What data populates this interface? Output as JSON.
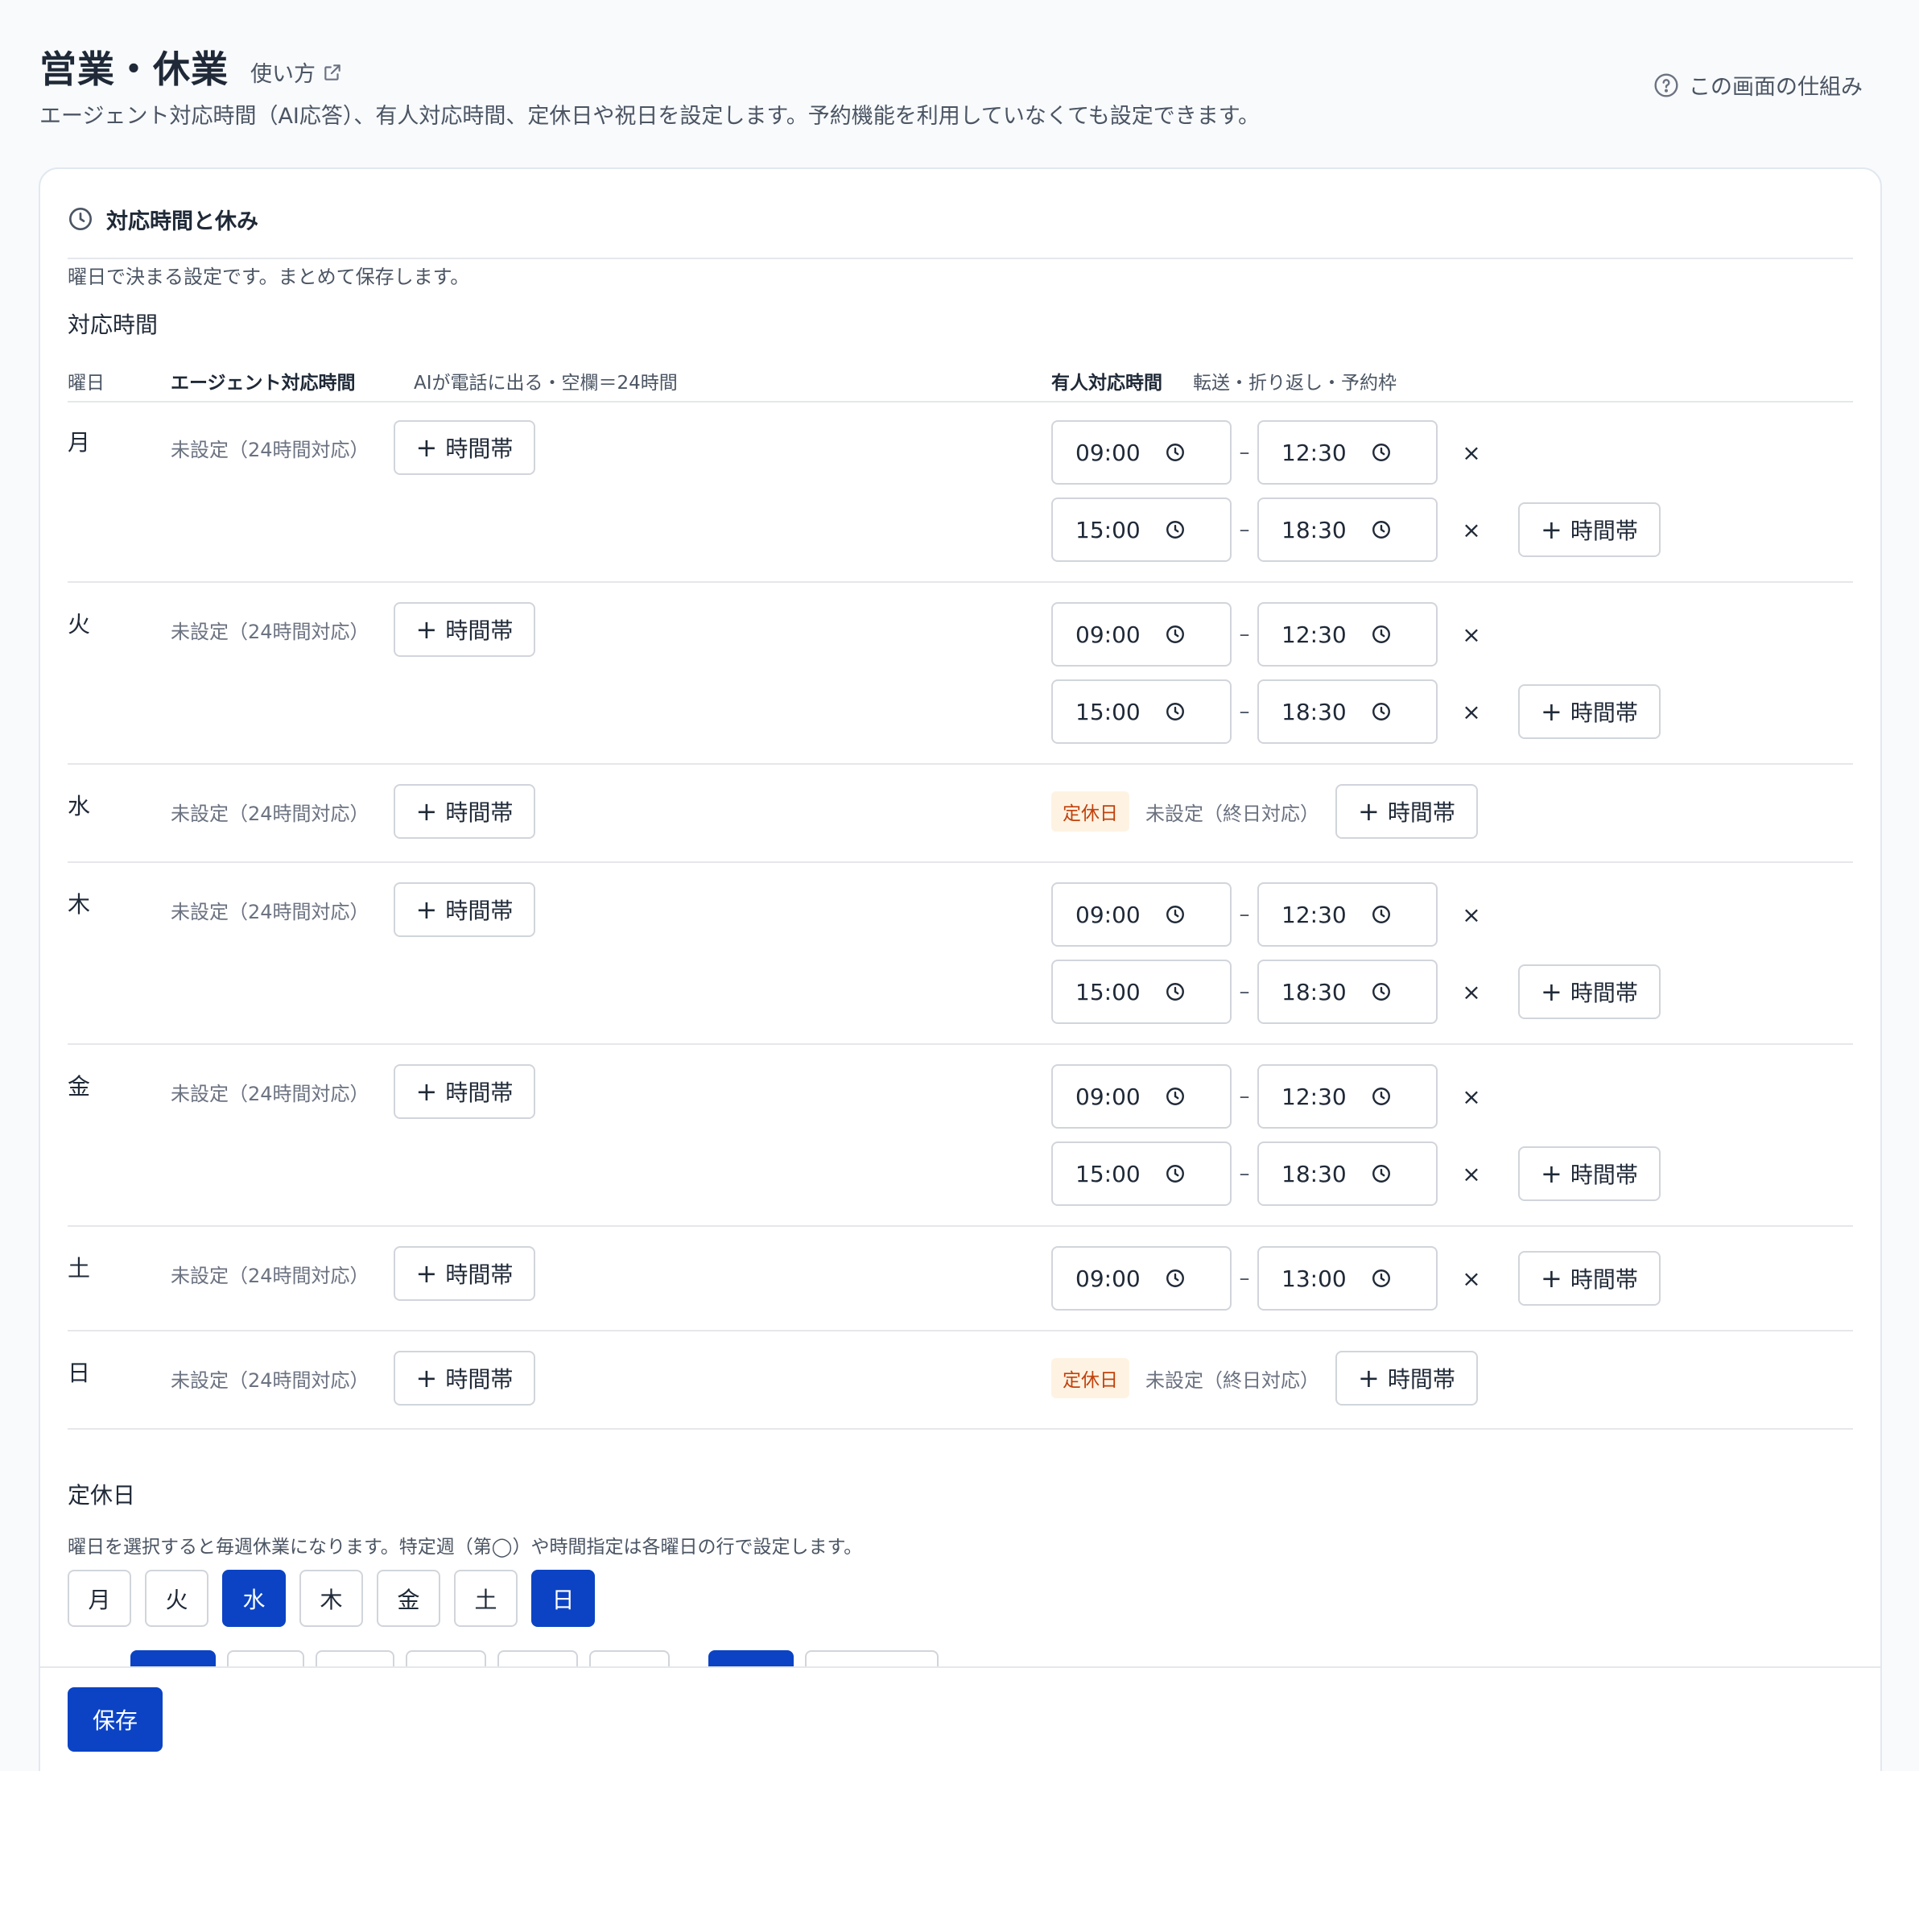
{
  "header": {
    "title": "営業・休業",
    "help_link": "使い方",
    "subtitle": "エージェント対応時間（AI応答）、有人対応時間、定休日や祝日を設定します。予約機能を利用していなくても設定できます。",
    "howto": "この画面の仕組み"
  },
  "card": {
    "title": "対応時間と休み",
    "description": "曜日で決まる設定です。まとめて保存します。",
    "section_title": "対応時間",
    "columns": {
      "day": "曜日",
      "agent": "エージェント対応時間",
      "agent_hint": "AIが電話に出る・空欄＝24時間",
      "human": "有人対応時間",
      "human_hint": "転送・折り返し・予約枠"
    },
    "agent_unset": "未設定（24時間対応）",
    "human_unset": "未設定（終日対応）",
    "closed_badge": "定休日",
    "add_label": "時間帯",
    "remove_label": "×",
    "range_sep": "–",
    "rows": [
      {
        "day": "月",
        "slots": [
          {
            "start": "09:00",
            "end": "12:30"
          },
          {
            "start": "15:00",
            "end": "18:30"
          }
        ]
      },
      {
        "day": "火",
        "slots": [
          {
            "start": "09:00",
            "end": "12:30"
          },
          {
            "start": "15:00",
            "end": "18:30"
          }
        ]
      },
      {
        "day": "水",
        "closed": true,
        "slots": []
      },
      {
        "day": "木",
        "slots": [
          {
            "start": "09:00",
            "end": "12:30"
          },
          {
            "start": "15:00",
            "end": "18:30"
          }
        ]
      },
      {
        "day": "金",
        "slots": [
          {
            "start": "09:00",
            "end": "12:30"
          },
          {
            "start": "15:00",
            "end": "18:30"
          }
        ]
      },
      {
        "day": "土",
        "slots": [
          {
            "start": "09:00",
            "end": "13:00"
          }
        ]
      },
      {
        "day": "日",
        "closed": true,
        "slots": []
      }
    ]
  },
  "closed_days": {
    "title": "定休日",
    "description": "曜日を選択すると毎週休業になります。特定週（第◯）や時間指定は各曜日の行で設定します。",
    "days": [
      {
        "label": "月",
        "selected": false
      },
      {
        "label": "火",
        "selected": false
      },
      {
        "label": "水",
        "selected": true
      },
      {
        "label": "木",
        "selected": false
      },
      {
        "label": "金",
        "selected": false
      },
      {
        "label": "土",
        "selected": false
      },
      {
        "label": "日",
        "selected": true
      }
    ]
  },
  "footer": {
    "save_label": "保存"
  },
  "colors": {
    "primary": "#0b43c4",
    "badge_bg": "#fef3e2",
    "badge_text": "#c2410c",
    "border": "#d1d5db"
  },
  "icons": {
    "help_link": "external-link-icon",
    "howto": "question-circle-icon",
    "card": "clock-icon",
    "time": "clock-icon"
  }
}
